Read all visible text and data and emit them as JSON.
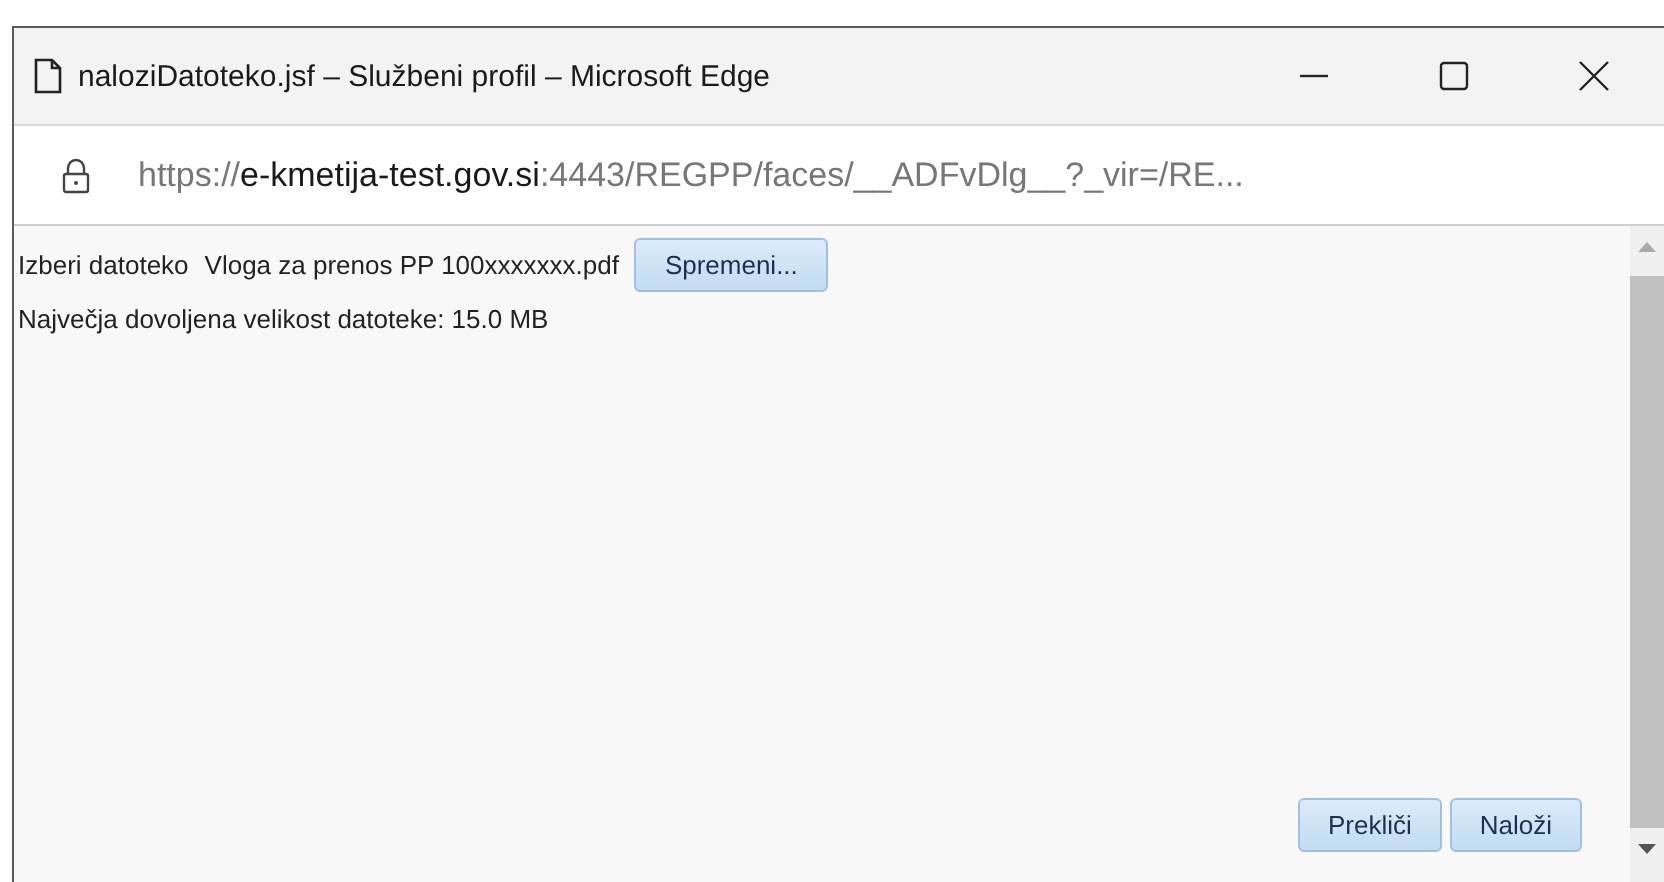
{
  "window": {
    "title": "naloziDatoteko.jsf – Službeni profil – Microsoft Edge"
  },
  "address_bar": {
    "scheme": "https://",
    "host": "e-kmetija-test.gov.si",
    "rest": ":4443/REGPP/faces/__ADFvDlg__?_vir=/RE..."
  },
  "form": {
    "file_label": "Izberi datoteko",
    "file_name": "Vloga za prenos PP 100xxxxxxx.pdf",
    "change_button": "Spremeni...",
    "size_note": "Največja dovoljena velikost datoteke: 15.0 MB"
  },
  "buttons": [
    "Prekliči",
    "Naloži"
  ]
}
